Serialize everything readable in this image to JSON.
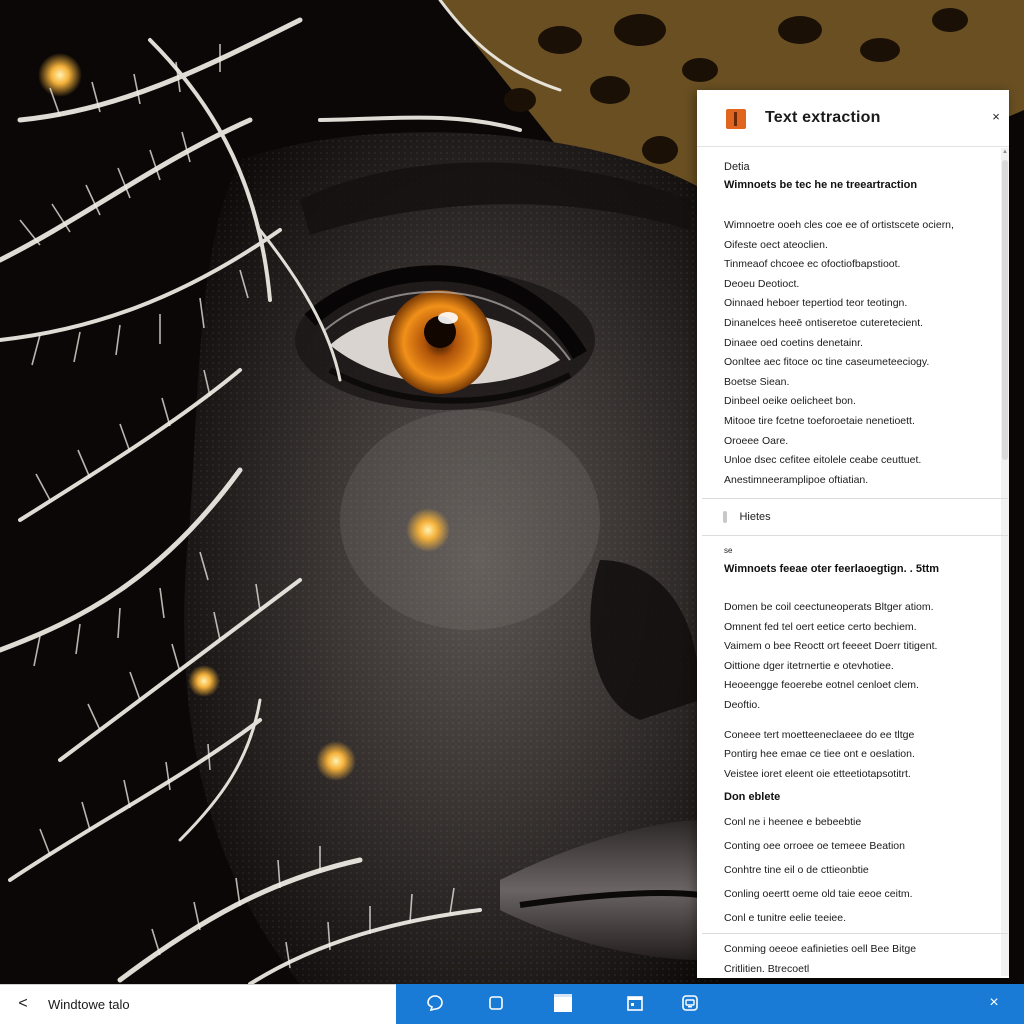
{
  "panel": {
    "title": "Text extraction",
    "close_label": "×",
    "section1": {
      "label": "Detia",
      "title": "Wimnoets be tec he ne treeartraction",
      "lines": [
        "Wimnoetre ooeh cles coe ee of ortistscete ociern,",
        "Oifeste oect ateoclien.",
        "Tinmeaof chcoee ec ofoctiofbapstioot.",
        "Deoeu Deotioct.",
        "Oinnaed heboer tepertiod teor teotingn.",
        "Dinanelces heeē ontiseretoe cuteretecient.",
        "Dinaee oed coetins denetainr.",
        "Oonltee aec fitoce oc tine caseumeteeciogy.",
        "Boetse Siean.",
        "Dinbeel oeike oelicheet bon.",
        "Mitooe tire fcetne toeforoetaie nenetioett.",
        "Oroeee Oare.",
        "Unloe dsec cefitee eitolele ceabe ceuttuet.",
        "Anestimneeramplipoe oftiatian."
      ]
    },
    "toggle_label": "Hietes",
    "section2": {
      "label": "se",
      "title": "Wimnoets feeae oter feerlaoegtign. . 5ttm",
      "lines": [
        "Domen be coil ceectuneoperats Bltger atiom.",
        "Omnent fed tel oert eetice certo bechiem.",
        "Vaimem o bee Reoctt ort feeeet Doerr titigent.",
        "Oittione dger itetrnertie e otevhotiee.",
        "Heoeengge feoerebe eotnel cenloet clem.",
        "Deoftio."
      ],
      "lines_b": [
        "Coneee tert moetteeneclaeee do ee tltge",
        "Pontirg hee emae ce tiee ont e oeslation.",
        "Veistee ioret eleent oie etteetiotapsotitrt."
      ],
      "subtitle": "Don eblete",
      "lines_c": [
        "Conl ne i heenee e bebeebtie",
        "Conting oee orroee oe temeee Beation",
        "Conhtre tine eil o de cttieonbtie",
        "Conling oeertt oeme old taie eeoe ceitm.",
        "Conl e tunitre eelie teeiee."
      ]
    },
    "section3": {
      "lines": [
        "Conming oeeoe eafinieties oell Bee Bitge",
        "Critlitien. Btrecoetl"
      ]
    }
  },
  "taskbar": {
    "back_label": "<",
    "title": "Windtowe talo",
    "close_label": "×"
  },
  "colors": {
    "accent": "#1a7bd6",
    "app_icon": "#e0661f",
    "iris": "#e6860f"
  },
  "icons": [
    "chevron-left-icon",
    "chat-icon",
    "square-icon",
    "window-icon",
    "calendar-icon",
    "settings-app-icon",
    "close-icon"
  ]
}
